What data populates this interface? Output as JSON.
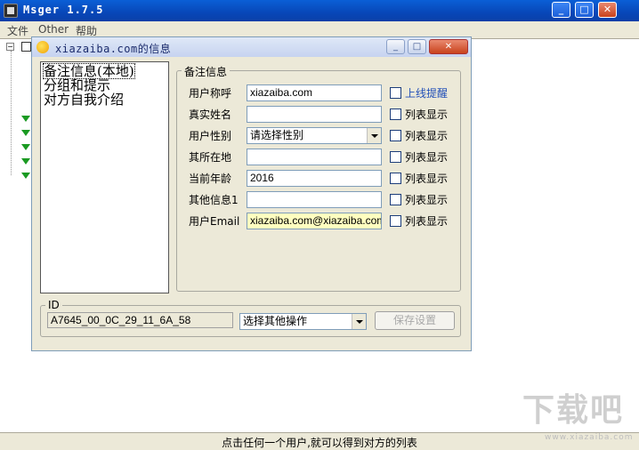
{
  "main_window": {
    "title": "Msger 1.7.5",
    "menu": [
      "文件",
      "Other",
      "帮助"
    ],
    "controls": {
      "minimize": "_",
      "maximize": "□",
      "close": "✕"
    }
  },
  "status_bar": {
    "text": "点击任何一个用户,就可以得到对方的列表"
  },
  "watermark": {
    "text": "下载吧",
    "url": "www.xiazaiba.com"
  },
  "dialog": {
    "title": "xiazaiba.com的信息",
    "controls": {
      "minimize": "_",
      "maximize": "□",
      "close": "✕"
    },
    "categories": [
      "备注信息(本地)",
      "分组和提示",
      "对方自我介绍"
    ],
    "selected_category": 0,
    "group_title": "备注信息",
    "fields": [
      {
        "label": "用户称呼",
        "value": "xiazaiba.com",
        "type": "text",
        "check_label": "上线提醒",
        "checked": false,
        "link": true
      },
      {
        "label": "真实姓名",
        "value": "",
        "type": "text",
        "check_label": "列表显示",
        "checked": false
      },
      {
        "label": "用户性别",
        "value": "请选择性别",
        "type": "select",
        "check_label": "列表显示",
        "checked": false
      },
      {
        "label": "其所在地",
        "value": "",
        "type": "text",
        "check_label": "列表显示",
        "checked": false
      },
      {
        "label": "当前年龄",
        "value": "2016",
        "type": "text",
        "check_label": "列表显示",
        "checked": false
      },
      {
        "label": "其他信息1",
        "value": "",
        "type": "text",
        "check_label": "列表显示",
        "checked": false
      },
      {
        "label": "用户Email",
        "value": "xiazaiba.com@xiazaiba.com",
        "type": "text",
        "check_label": "列表显示",
        "checked": false,
        "highlight": true
      }
    ],
    "id_group_label": "ID",
    "id_value": "A7645_00_0C_29_11_6A_58",
    "operation_select": "选择其他操作",
    "save_button": "保存设置"
  },
  "colors": {
    "titlebar": "#0a5fd6",
    "window_bg": "#ece9d8",
    "highlight_field": "#ffffc0",
    "link": "#2250b8",
    "tree_arrow": "#1a9a22"
  }
}
